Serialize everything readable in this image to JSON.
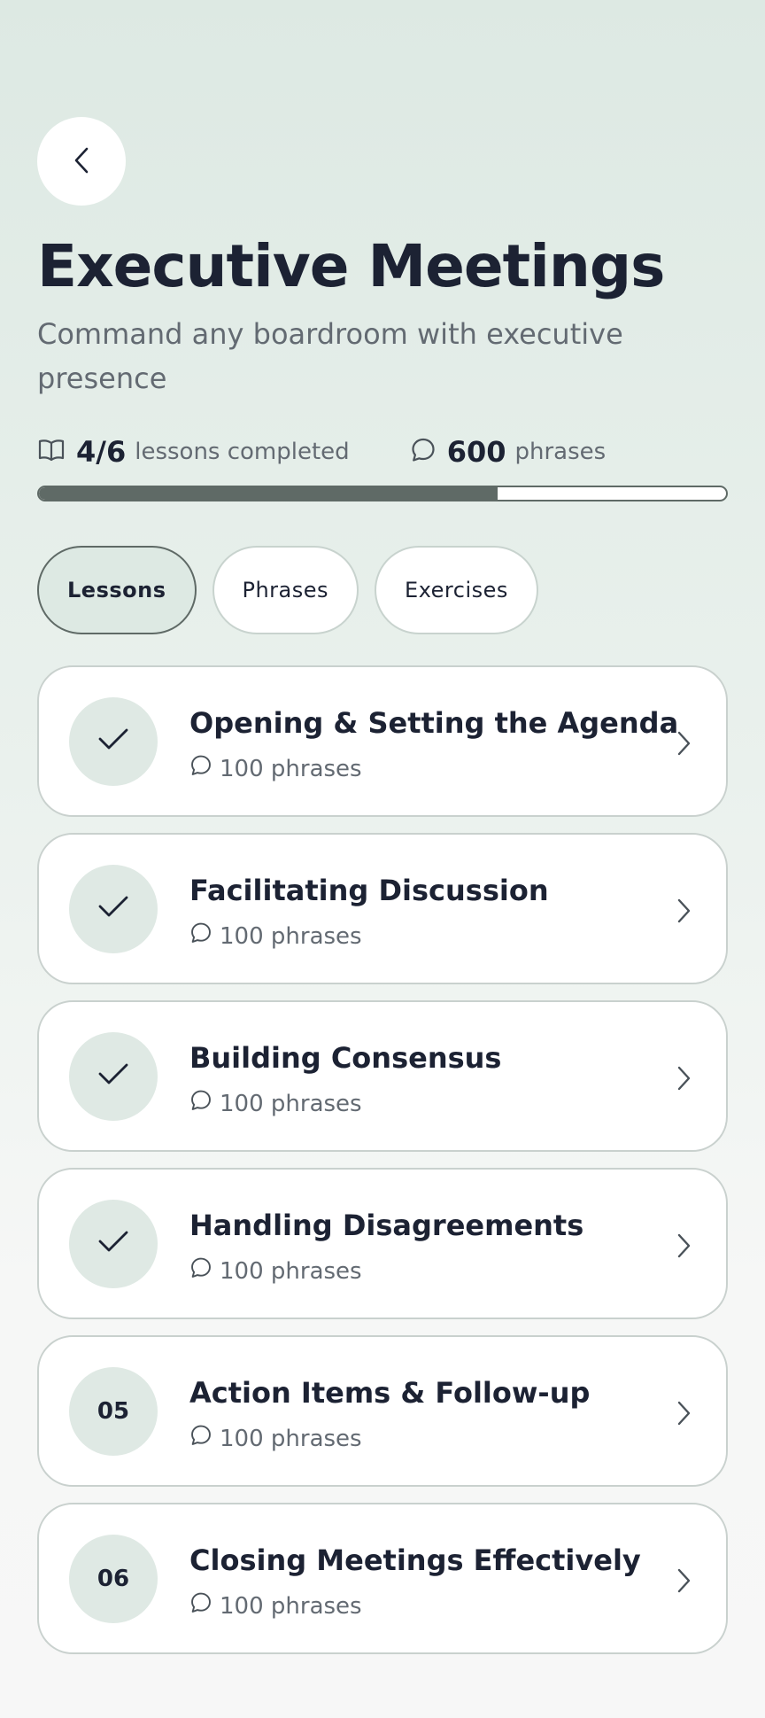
{
  "header": {
    "title": "Executive Meetings",
    "subtitle": "Command any boardroom with executive presence"
  },
  "stats": {
    "lessons_value": "4/6",
    "lessons_label": "lessons completed",
    "phrases_value": "600",
    "phrases_label": "phrases"
  },
  "progress": {
    "fraction": 0.667
  },
  "tabs": [
    {
      "label": "Lessons",
      "active": true
    },
    {
      "label": "Phrases",
      "active": false
    },
    {
      "label": "Exercises",
      "active": false
    }
  ],
  "lessons": [
    {
      "title": "Opening & Setting the Agenda",
      "phrases": "100 phrases",
      "status": "completed",
      "number": ""
    },
    {
      "title": "Facilitating Discussion",
      "phrases": "100 phrases",
      "status": "completed",
      "number": ""
    },
    {
      "title": "Building Consensus",
      "phrases": "100 phrases",
      "status": "completed",
      "number": ""
    },
    {
      "title": "Handling Disagreements",
      "phrases": "100 phrases",
      "status": "completed",
      "number": ""
    },
    {
      "title": "Action Items & Follow-up",
      "phrases": "100 phrases",
      "status": "pending",
      "number": "05"
    },
    {
      "title": "Closing Meetings Effectively",
      "phrases": "100 phrases",
      "status": "pending",
      "number": "06"
    }
  ],
  "icons": {
    "back": "chevron-left-icon",
    "lessons_stat": "book-open-icon",
    "phrases_stat": "chat-bubble-icon",
    "completed": "check-icon",
    "row_action": "chevron-right-icon"
  },
  "colors": {
    "text_primary": "#1c2233",
    "text_secondary": "#636a72",
    "accent": "#5f6a66",
    "badge_bg": "#dfe9e4"
  }
}
